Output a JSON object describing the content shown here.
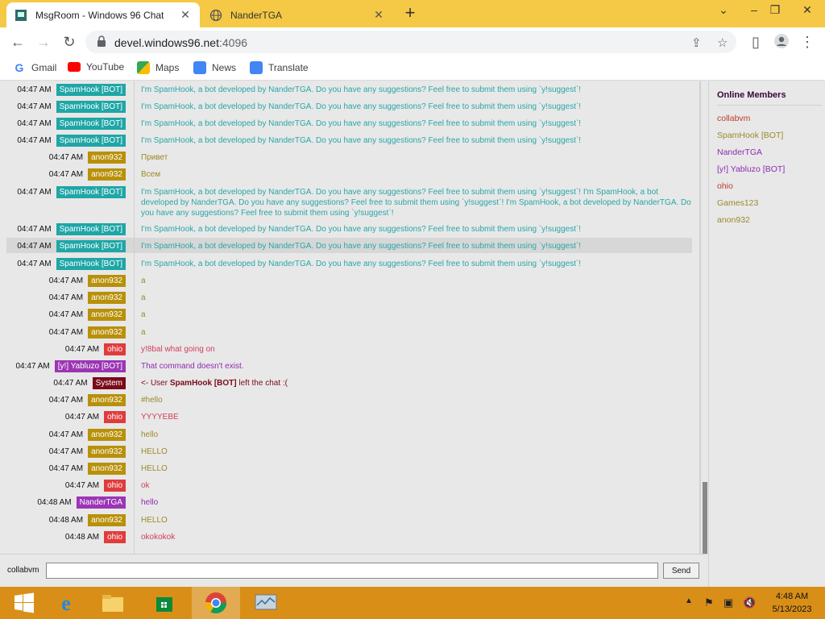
{
  "browser": {
    "tabs": [
      {
        "title": "MsgRoom - Windows 96 Chat",
        "active": true
      },
      {
        "title": "NanderTGA",
        "active": false
      }
    ],
    "url": "devel.windows96.net",
    "url_port": ":4096",
    "bookmarks": [
      "Gmail",
      "YouTube",
      "Maps",
      "News",
      "Translate"
    ]
  },
  "members_title": "Online Members",
  "members": [
    {
      "name": "collabvm",
      "color": "#c0392b"
    },
    {
      "name": "SpamHook [BOT]",
      "color": "#9a8a2a"
    },
    {
      "name": "NanderTGA",
      "color": "#8e2bb0"
    },
    {
      "name": "[y!] Yabluzo [BOT]",
      "color": "#8e2bb0"
    },
    {
      "name": "ohio",
      "color": "#c0392b"
    },
    {
      "name": "Games123",
      "color": "#9a8a2a"
    },
    {
      "name": "anon932",
      "color": "#9a8a2a"
    }
  ],
  "messages": [
    {
      "time": "04:47 AM",
      "user": "SpamHook [BOT]",
      "tag_color": "#1fa6a6",
      "text": "I'm SpamHook, a bot developed by NanderTGA. Do you have any suggestions? Feel free to submit them using `y!suggest`!",
      "text_color": "#2aa6a6"
    },
    {
      "time": "04:47 AM",
      "user": "SpamHook [BOT]",
      "tag_color": "#1fa6a6",
      "text": "I'm SpamHook, a bot developed by NanderTGA. Do you have any suggestions? Feel free to submit them using `y!suggest`!",
      "text_color": "#2aa6a6"
    },
    {
      "time": "04:47 AM",
      "user": "SpamHook [BOT]",
      "tag_color": "#1fa6a6",
      "text": "I'm SpamHook, a bot developed by NanderTGA. Do you have any suggestions? Feel free to submit them using `y!suggest`!",
      "text_color": "#2aa6a6"
    },
    {
      "time": "04:47 AM",
      "user": "SpamHook [BOT]",
      "tag_color": "#1fa6a6",
      "text": "I'm SpamHook, a bot developed by NanderTGA. Do you have any suggestions? Feel free to submit them using `y!suggest`!",
      "text_color": "#2aa6a6"
    },
    {
      "time": "04:47 AM",
      "user": "anon932",
      "tag_color": "#b8900a",
      "text": "Привет",
      "text_color": "#9a8a2a"
    },
    {
      "time": "04:47 AM",
      "user": "anon932",
      "tag_color": "#b8900a",
      "text": "Всем",
      "text_color": "#9a8a2a"
    },
    {
      "time": "04:47 AM",
      "user": "SpamHook [BOT]",
      "tag_color": "#1fa6a6",
      "text": "I'm SpamHook, a bot developed by NanderTGA. Do you have any suggestions? Feel free to submit them using `y!suggest`! I'm SpamHook, a bot developed by NanderTGA. Do you have any suggestions? Feel free to submit them using `y!suggest`! I'm SpamHook, a bot developed by NanderTGA. Do you have any suggestions? Feel free to submit them using `y!suggest`!",
      "text_color": "#2aa6a6"
    },
    {
      "time": "04:47 AM",
      "user": "SpamHook [BOT]",
      "tag_color": "#1fa6a6",
      "text": "I'm SpamHook, a bot developed by NanderTGA. Do you have any suggestions? Feel free to submit them using `y!suggest`!",
      "text_color": "#2aa6a6"
    },
    {
      "time": "04:47 AM",
      "user": "SpamHook [BOT]",
      "tag_color": "#1fa6a6",
      "text": "I'm SpamHook, a bot developed by NanderTGA. Do you have any suggestions? Feel free to submit them using `y!suggest`!",
      "text_color": "#2aa6a6",
      "highlight": true
    },
    {
      "time": "04:47 AM",
      "user": "SpamHook [BOT]",
      "tag_color": "#1fa6a6",
      "text": "I'm SpamHook, a bot developed by NanderTGA. Do you have any suggestions? Feel free to submit them using `y!suggest`!",
      "text_color": "#2aa6a6"
    },
    {
      "time": "04:47 AM",
      "user": "anon932",
      "tag_color": "#b8900a",
      "text": "a",
      "text_color": "#9a8a2a"
    },
    {
      "time": "04:47 AM",
      "user": "anon932",
      "tag_color": "#b8900a",
      "text": "a",
      "text_color": "#9a8a2a"
    },
    {
      "time": "04:47 AM",
      "user": "anon932",
      "tag_color": "#b8900a",
      "text": "a",
      "text_color": "#9a8a2a"
    },
    {
      "time": "04:47 AM",
      "user": "anon932",
      "tag_color": "#b8900a",
      "text": "a",
      "text_color": "#9a8a2a"
    },
    {
      "time": "04:47 AM",
      "user": "ohio",
      "tag_color": "#e03c3c",
      "text": "y!8bal what going on",
      "text_color": "#d0405a"
    },
    {
      "time": "04:47 AM",
      "user": "[y!] Yabluzo [BOT]",
      "tag_color": "#9b35b5",
      "text": "That command doesn't exist.",
      "text_color": "#8e2bb0"
    },
    {
      "time": "04:47 AM",
      "user": "System",
      "tag_color": "#7a0a1a",
      "text": "<- User ",
      "text_bold": "SpamHook [BOT]",
      "text_after": " left the chat :(",
      "text_color": "#7a0a1a",
      "system": true
    },
    {
      "time": "04:47 AM",
      "user": "anon932",
      "tag_color": "#b8900a",
      "text": "#hello",
      "text_color": "#9a8a2a"
    },
    {
      "time": "04:47 AM",
      "user": "ohio",
      "tag_color": "#e03c3c",
      "text": "YYYYEBE",
      "text_color": "#d0405a"
    },
    {
      "time": "04:47 AM",
      "user": "anon932",
      "tag_color": "#b8900a",
      "text": "hello",
      "text_color": "#9a8a2a"
    },
    {
      "time": "04:47 AM",
      "user": "anon932",
      "tag_color": "#b8900a",
      "text": "HELLO",
      "text_color": "#9a8a2a"
    },
    {
      "time": "04:47 AM",
      "user": "anon932",
      "tag_color": "#b8900a",
      "text": "HELLO",
      "text_color": "#9a8a2a"
    },
    {
      "time": "04:47 AM",
      "user": "ohio",
      "tag_color": "#e03c3c",
      "text": "ok",
      "text_color": "#d0405a"
    },
    {
      "time": "04:48 AM",
      "user": "NanderTGA",
      "tag_color": "#9b35b5",
      "text": "hello",
      "text_color": "#8e2bb0"
    },
    {
      "time": "04:48 AM",
      "user": "anon932",
      "tag_color": "#b8900a",
      "text": "HELLO",
      "text_color": "#9a8a2a"
    },
    {
      "time": "04:48 AM",
      "user": "ohio",
      "tag_color": "#e03c3c",
      "text": "okokokok",
      "text_color": "#d0405a"
    }
  ],
  "input": {
    "nick": "collabvm",
    "value": "",
    "send_label": "Send"
  },
  "taskbar": {
    "time": "4:48 AM",
    "date": "5/13/2023"
  }
}
